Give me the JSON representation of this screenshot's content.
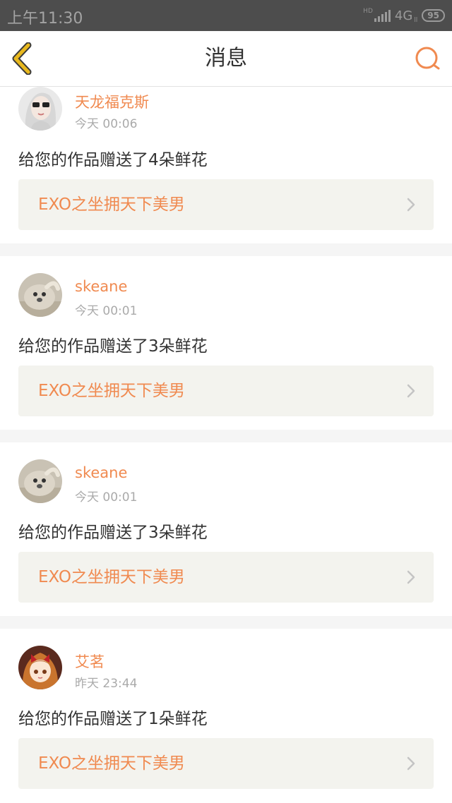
{
  "status_bar": {
    "time": "上午11:30",
    "hd": "HD",
    "network": "4G",
    "network_sub": "ll",
    "battery": "95"
  },
  "header": {
    "title": "消息",
    "back_icon": "chevron-left-icon",
    "search_icon": "search-icon"
  },
  "colors": {
    "accent": "#f08a50",
    "back_arrow": "#e8b81e",
    "card_bg": "#ffffff",
    "work_bg": "#f3f3ee",
    "page_bg": "#f5f5f5"
  },
  "messages": [
    {
      "user": "天龙福克斯",
      "time": "今天 00:06",
      "text": "给您的作品赠送了4朵鲜花",
      "work_title": "EXO之坐拥天下美男",
      "avatar": "avatar-girl-sunglasses"
    },
    {
      "user": "skeane",
      "time": "今天 00:01",
      "text": "给您的作品赠送了3朵鲜花",
      "work_title": "EXO之坐拥天下美男",
      "avatar": "avatar-seal"
    },
    {
      "user": "skeane",
      "time": "今天 00:01",
      "text": "给您的作品赠送了3朵鲜花",
      "work_title": "EXO之坐拥天下美男",
      "avatar": "avatar-seal"
    },
    {
      "user": "艾茗",
      "time": "昨天 23:44",
      "text": "给您的作品赠送了1朵鲜花",
      "work_title": "EXO之坐拥天下美男",
      "avatar": "avatar-anime-girl"
    }
  ]
}
